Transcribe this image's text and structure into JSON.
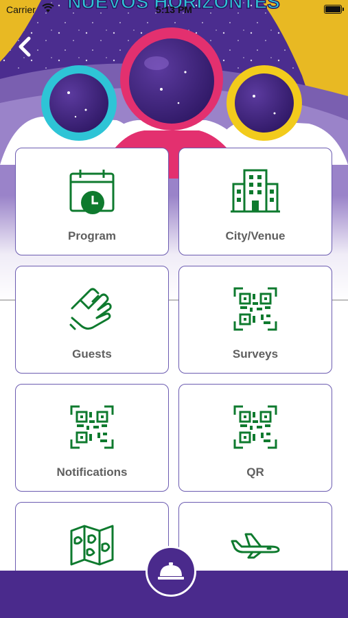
{
  "status_bar": {
    "carrier": "Carrier",
    "time": "5:13 PM"
  },
  "hero": {
    "banner_text": "NUEVOS HORIZONTES"
  },
  "menu": {
    "items": [
      {
        "label": "Program",
        "icon": "calendar-clock-icon"
      },
      {
        "label": "City/Venue",
        "icon": "building-icon"
      },
      {
        "label": "Guests",
        "icon": "handshake-icon"
      },
      {
        "label": "Surveys",
        "icon": "qr-code-icon"
      },
      {
        "label": "Notifications",
        "icon": "qr-code-icon"
      },
      {
        "label": "QR",
        "icon": "qr-code-icon"
      },
      {
        "label": "",
        "icon": "map-icon"
      },
      {
        "label": "",
        "icon": "airplane-icon"
      }
    ]
  },
  "bottom_bar": {
    "button_icon": "service-bell-icon"
  },
  "colors": {
    "primary_purple": "#4a2a8c",
    "icon_green": "#0e7a2e",
    "label_gray": "#5f5f5f",
    "tile_border": "#6b5bb0"
  }
}
